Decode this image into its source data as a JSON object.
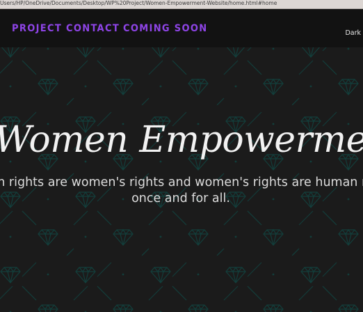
{
  "browser": {
    "address": "Users/HP/OneDrive/Documents/Desktop/WP%20Project/Women-Empowerment-Website/home.html#home"
  },
  "nav": {
    "items": [
      "PROJECT",
      "CONTACT",
      "COMING SOON"
    ],
    "theme_toggle": "Dark"
  },
  "hero": {
    "title": "Women Empowerment",
    "quote_line1": "Human rights are women's rights and women's rights are human rights,",
    "quote_line2": "once and for all."
  },
  "colors": {
    "nav_link": "#8e44e6",
    "background": "#1b1b1b",
    "pattern": "#0e3b38",
    "title": "#f2f2f2"
  }
}
